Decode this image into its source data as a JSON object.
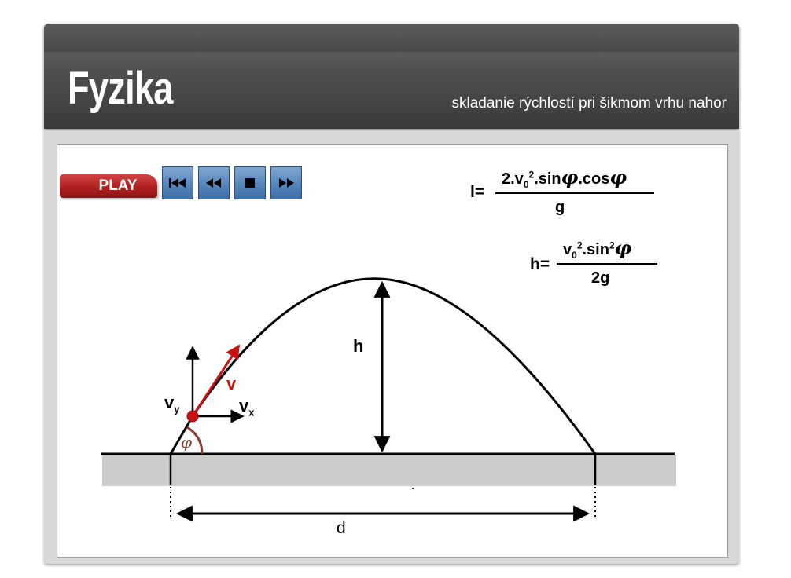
{
  "header": {
    "title": "Fyzika",
    "subtitle": "skladanie rýchlostí pri šikmom vrhu nahor"
  },
  "controls": {
    "play_label": "PLAY",
    "buttons": [
      {
        "name": "skip-to-start",
        "icon": "skip-back-icon"
      },
      {
        "name": "rewind",
        "icon": "rewind-icon"
      },
      {
        "name": "stop",
        "icon": "stop-icon"
      },
      {
        "name": "fast-forward",
        "icon": "fast-forward-icon"
      }
    ]
  },
  "formulas": {
    "range": {
      "lhs": "l=",
      "numerator_a": "2.v",
      "numerator_sub": "0",
      "numerator_sup": "2",
      "numerator_b": ".sin",
      "numerator_c": ".cos",
      "angle_symbol": "φ",
      "denominator": "g"
    },
    "height": {
      "lhs": "h=",
      "numerator_a": "v",
      "numerator_sub": "0",
      "numerator_sup": "2",
      "numerator_b": ".sin",
      "numerator_sup2": "2",
      "angle_symbol": "φ",
      "denominator": "2g"
    }
  },
  "diagram": {
    "label_h": "h",
    "label_d": "d",
    "label_v": "v",
    "label_vy": "v",
    "label_vy_sub": "y",
    "label_vx": "v",
    "label_vx_sub": "x",
    "label_phi": "φ",
    "colors": {
      "velocity": "#cc1111",
      "angle_arc": "#8b3a2a",
      "ground": "#cccccc"
    }
  }
}
